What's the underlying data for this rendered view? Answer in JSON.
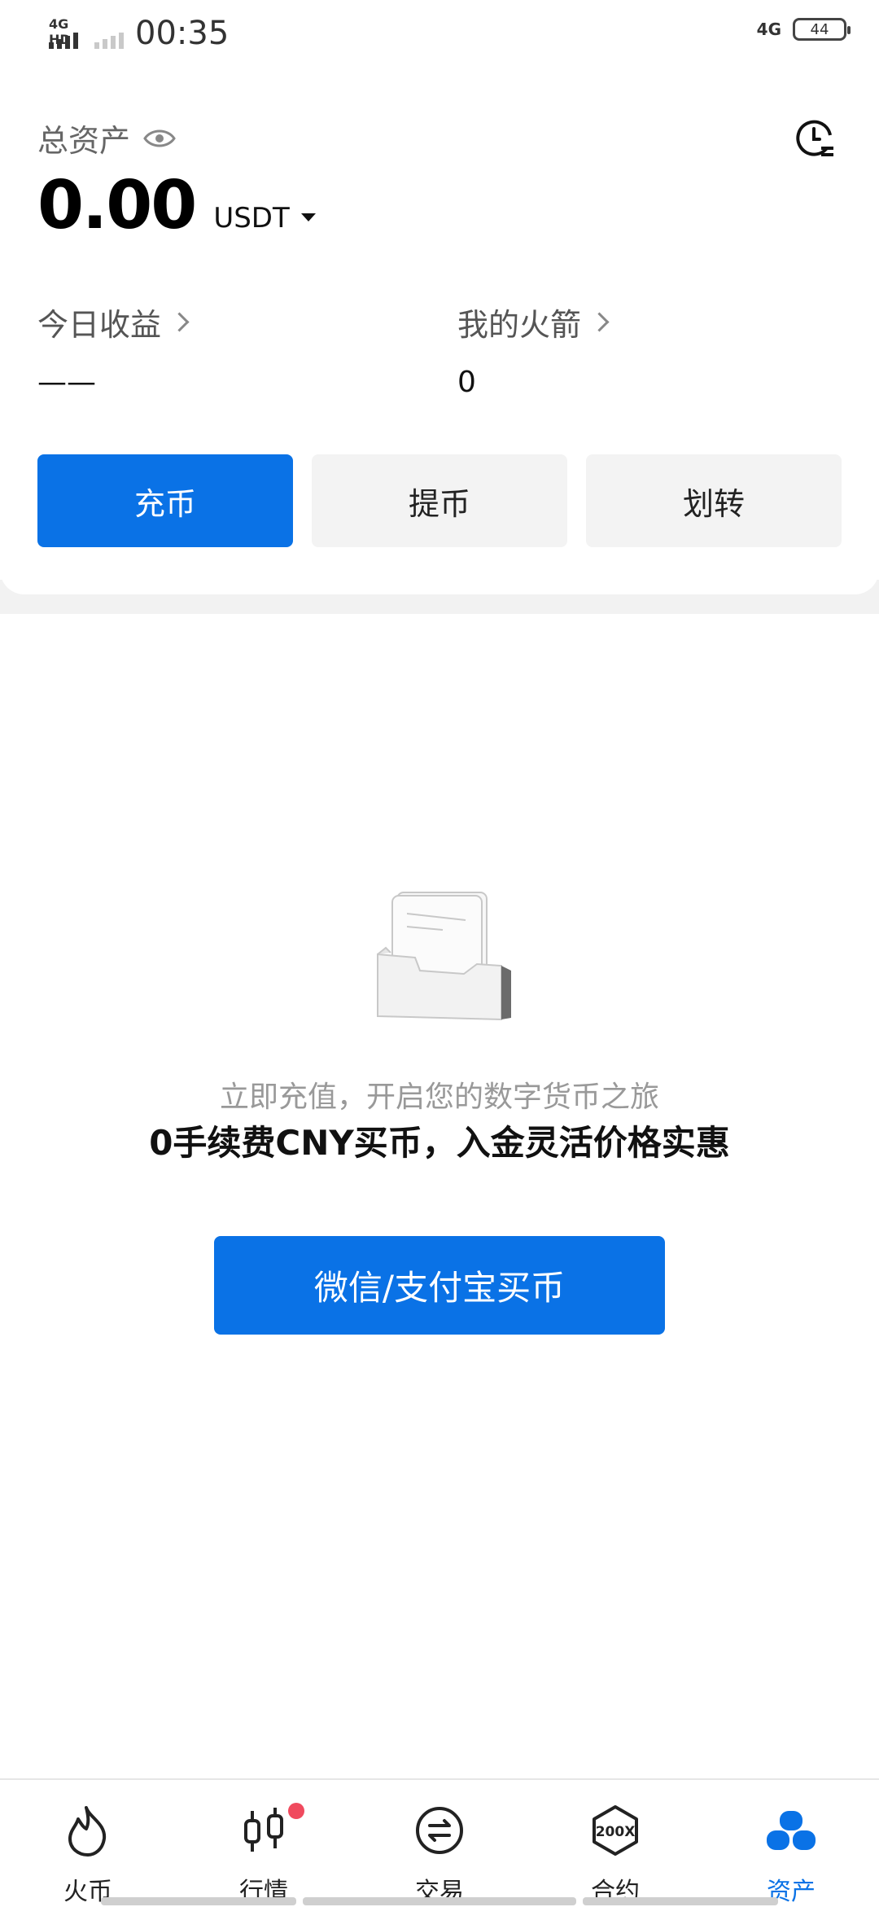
{
  "status_bar": {
    "network_label": "4G HD",
    "time": "00:35",
    "right_network": "4G",
    "battery": "44"
  },
  "header": {
    "total_assets_label": "总资产",
    "eye_icon": "eye-icon",
    "history_icon": "clock-history-icon"
  },
  "balance": {
    "amount": "0.00",
    "unit": "USDT"
  },
  "stats": {
    "today_label": "今日收益",
    "today_value": "——",
    "rocket_label": "我的火箭",
    "rocket_value": "0"
  },
  "actions": {
    "deposit": "充币",
    "withdraw": "提币",
    "transfer": "划转"
  },
  "empty_state": {
    "line1": "立即充值，开启您的数字货币之旅",
    "line2": "0手续费CNY买币，入金灵活价格实惠",
    "buy_button": "微信/支付宝买币"
  },
  "tabs": [
    {
      "label": "火币",
      "icon": "flame-icon"
    },
    {
      "label": "行情",
      "icon": "candlestick-icon"
    },
    {
      "label": "交易",
      "icon": "exchange-icon"
    },
    {
      "label": "合约",
      "icon": "200x-icon"
    },
    {
      "label": "资产",
      "icon": "assets-icon",
      "active": true
    }
  ],
  "colors": {
    "accent": "#0a72e6",
    "badge": "#f04a5e"
  }
}
